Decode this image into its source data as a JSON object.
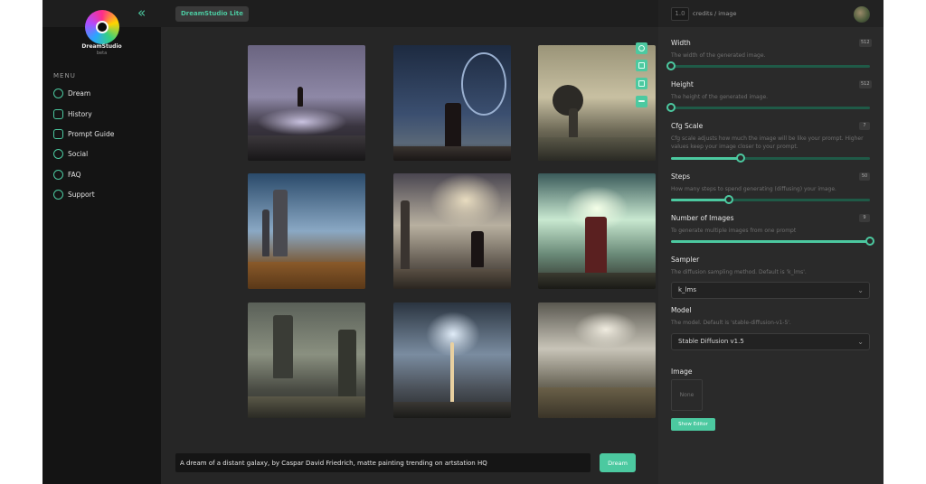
{
  "sidebar": {
    "brand": "DreamStudio",
    "brand_sub": "beta",
    "collapse_glyph": "«",
    "menu_label": "MENU",
    "items": [
      {
        "label": "Dream",
        "icon": "moon-icon"
      },
      {
        "label": "History",
        "icon": "image-icon"
      },
      {
        "label": "Prompt Guide",
        "icon": "chat-icon"
      },
      {
        "label": "Social",
        "icon": "users-icon"
      },
      {
        "label": "FAQ",
        "icon": "question-icon"
      },
      {
        "label": "Support",
        "icon": "support-icon"
      }
    ]
  },
  "topbar": {
    "tab_label": "DreamStudio Lite"
  },
  "credits": {
    "value": "1.0",
    "label": "credits / image"
  },
  "prompt": {
    "value": "A dream of a distant galaxy, by Caspar David Friedrich, matte painting trending on artstation HQ",
    "button": "Dream"
  },
  "settings": {
    "width": {
      "title": "Width",
      "value": "512",
      "desc": "The width of the generated image.",
      "fraction": 0.0
    },
    "height": {
      "title": "Height",
      "value": "512",
      "desc": "The height of the generated image.",
      "fraction": 0.0
    },
    "cfg": {
      "title": "Cfg Scale",
      "value": "7",
      "desc": "Cfg scale adjusts how much the image will be like your prompt. Higher values keep your image closer to your prompt.",
      "fraction": 0.35
    },
    "steps": {
      "title": "Steps",
      "value": "50",
      "desc": "How many steps to spend generating (diffusing) your image.",
      "fraction": 0.29
    },
    "num_images": {
      "title": "Number of Images",
      "value": "9",
      "desc": "To generate multiple images from one prompt",
      "fraction": 1.0
    },
    "sampler": {
      "title": "Sampler",
      "desc": "The diffusion sampling method. Default is 'k_lms'.",
      "selected": "k_lms"
    },
    "model": {
      "title": "Model",
      "desc": "The model. Default is 'stable-diffusion-v1-5'.",
      "selected": "Stable Diffusion v1.5"
    },
    "image": {
      "title": "Image",
      "placeholder": "None",
      "button": "Show Editor"
    }
  },
  "colors": {
    "accent": "#4cc9a0",
    "bg": "#222222",
    "sidebar": "#141414",
    "panel": "#2a2a2a"
  }
}
